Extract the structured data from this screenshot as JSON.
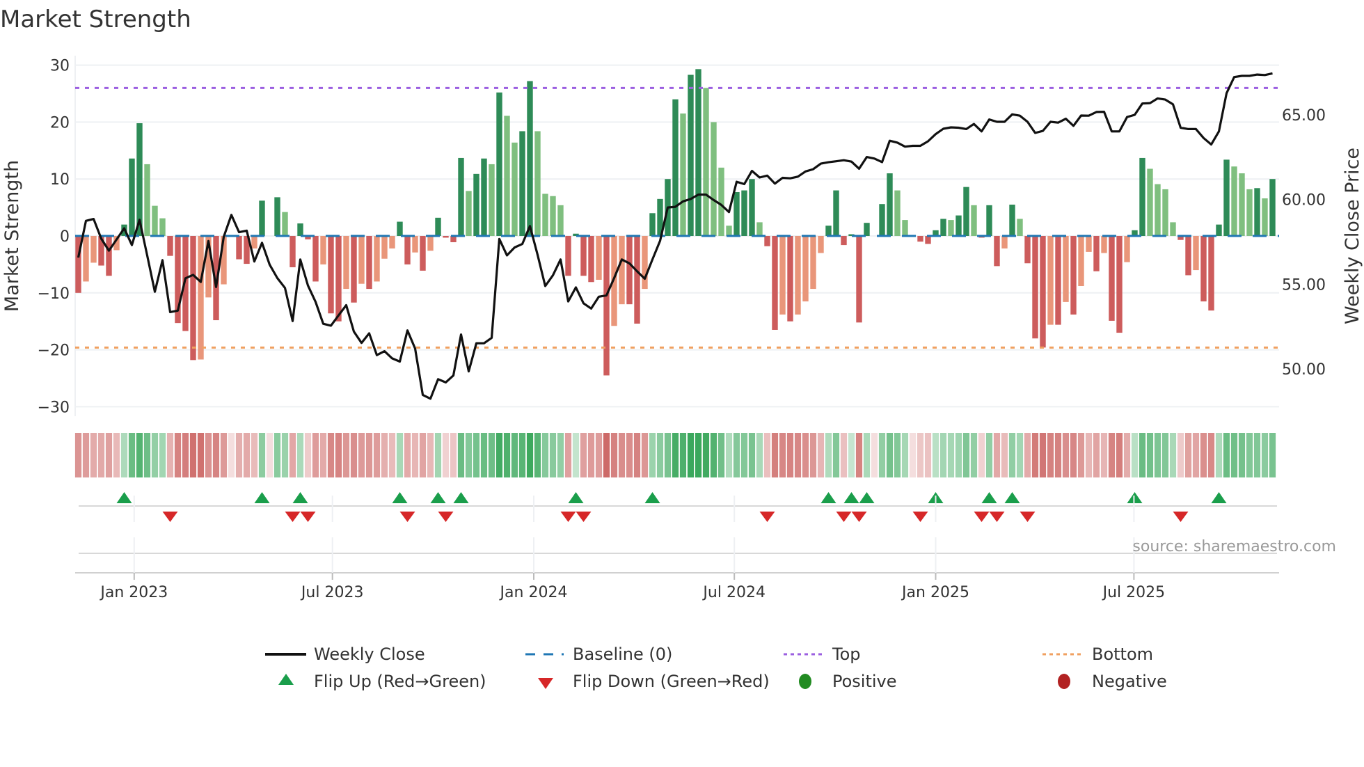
{
  "chart_data": {
    "type": "bar",
    "title": "Market Strength",
    "ylabel": "Market Strength",
    "y2label": "Weekly Close Price",
    "ylim": [
      -31.5,
      33
    ],
    "y2lim": [
      47.7,
      67.9
    ],
    "yticks": [
      "30",
      "20",
      "10",
      "0",
      "−10",
      "−20",
      "−30"
    ],
    "ytick_values": [
      30,
      20,
      10,
      0,
      -10,
      -20,
      -30
    ],
    "y2ticks": [
      "65.00",
      "60.00",
      "55.00",
      "50.00"
    ],
    "y2tick_values": [
      65,
      60,
      55,
      50
    ],
    "xticks": [
      "Jan 2023",
      "Jul 2023",
      "Jan 2024",
      "Jul 2024",
      "Jan 2025",
      "Jul 2025"
    ],
    "xtick_week_index": [
      7.3,
      33.2,
      59.5,
      85.7,
      112,
      137.9
    ],
    "top_level": 26,
    "bottom_level": -19.6,
    "baseline": 0,
    "colors": {
      "positive_strong": "#2e8b57",
      "positive_weak": "#7fbf7f",
      "negative_strong": "#cd5c5c",
      "negative_weak": "#e9967a",
      "baseline": "#1f77b4",
      "top": "#9b5fe0",
      "bottom": "#f0a060",
      "close": "#111111",
      "flip_up": "#1a9e4b",
      "flip_down": "#d62728",
      "positive_dot": "#228b22",
      "negative_dot": "#b22222"
    },
    "strength": [
      -10,
      -8,
      -4.7,
      -5.2,
      -7,
      -2.5,
      2,
      13.6,
      19.8,
      12.6,
      5.3,
      3.1,
      -3.5,
      -15.3,
      -16.7,
      -21.8,
      -21.7,
      -10.8,
      -14.8,
      -8.5,
      0,
      -4.1,
      -4.9,
      -2.2,
      6.2,
      0,
      6.8,
      4.2,
      -5.5,
      2.2,
      -0.6,
      -8,
      -5,
      -13.6,
      -15,
      -9.3,
      -11.7,
      -8.4,
      -9.3,
      -8,
      -4,
      -2.2,
      2.5,
      -5,
      -2.9,
      -6.1,
      -2.6,
      3.2,
      -0.3,
      -1.1,
      13.7,
      7.9,
      10.9,
      13.6,
      12.6,
      25.2,
      21.1,
      16.4,
      18.4,
      27.2,
      18.4,
      7.4,
      7,
      5.4,
      -7,
      0.4,
      -7,
      -8.1,
      -7.7,
      -24.5,
      -15.8,
      -12,
      -12,
      -15.4,
      -9.3,
      4,
      6.5,
      10,
      24,
      21.5,
      28.3,
      29.3,
      26,
      20,
      12,
      1.8,
      7.7,
      8,
      10,
      2.4,
      -1.8,
      -16.5,
      -13.8,
      -15,
      -13.8,
      -11.5,
      -9.3,
      -3,
      1.8,
      8,
      -1.6,
      0.3,
      -15.2,
      2.3,
      0,
      5.6,
      11,
      8,
      2.8,
      0,
      -1,
      -1.4,
      1,
      3,
      2.8,
      3.6,
      8.6,
      5.4,
      -0.3,
      5.4,
      -5.3,
      -2.2,
      5.5,
      3,
      -4.8,
      -18,
      -19.6,
      -15.6,
      -15.6,
      -11.6,
      -13.8,
      -8.8,
      -2.8,
      -6.2,
      -3,
      -14.9,
      -17,
      -4.6,
      1,
      13.7,
      11.8,
      9.1,
      8.2,
      2.4,
      -0.7,
      -6.9,
      -6,
      -11.5,
      -13.1,
      2,
      13.4,
      12.2,
      11,
      8.2,
      8.4,
      6.6,
      10
    ],
    "weekly_close": [
      56.57,
      58.74,
      58.85,
      57.69,
      56.98,
      57.64,
      58.3,
      57.31,
      58.8,
      56.7,
      54.55,
      56.42,
      53.35,
      53.44,
      55.35,
      55.55,
      55.13,
      57.55,
      54.83,
      57.8,
      59.09,
      58.07,
      58.16,
      56.34,
      57.44,
      56.15,
      55.36,
      54.78,
      52.82,
      56.46,
      54.92,
      53.95,
      52.66,
      52.55,
      53.16,
      53.76,
      52.2,
      51.53,
      52.1,
      50.81,
      51.04,
      50.62,
      50.43,
      52.27,
      51.2,
      48.46,
      48.24,
      49.39,
      49.2,
      49.61,
      52.03,
      49.85,
      51.51,
      51.51,
      51.83,
      57.67,
      56.7,
      57.17,
      57.37,
      58.43,
      56.73,
      54.89,
      55.52,
      56.46,
      53.98,
      54.81,
      53.87,
      53.56,
      54.26,
      54.34,
      55.36,
      56.46,
      56.23,
      55.76,
      55.32,
      56.46,
      57.56,
      59.53,
      59.57,
      59.89,
      60.03,
      60.29,
      60.29,
      59.97,
      59.68,
      59.26,
      61.05,
      60.91,
      61.69,
      61.3,
      61.41,
      60.94,
      61.28,
      61.25,
      61.35,
      61.66,
      61.79,
      62.12,
      62.2,
      62.26,
      62.32,
      62.24,
      61.82,
      62.51,
      62.42,
      62.21,
      63.47,
      63.36,
      63.12,
      63.17,
      63.17,
      63.44,
      63.86,
      64.18,
      64.26,
      64.24,
      64.16,
      64.46,
      64.02,
      64.73,
      64.59,
      64.59,
      65.03,
      64.95,
      64.59,
      63.93,
      64.05,
      64.59,
      64.54,
      64.77,
      64.35,
      64.96,
      64.95,
      65.17,
      65.18,
      64.02,
      64.02,
      64.87,
      65.0,
      65.67,
      65.69,
      65.97,
      65.9,
      65.62,
      64.24,
      64.16,
      64.16,
      63.63,
      63.25,
      64.02,
      66.28,
      67.23,
      67.3,
      67.3,
      67.38,
      67.35,
      67.45
    ],
    "flip_up_weeks": [
      6,
      24,
      29,
      42,
      47,
      50,
      65,
      75,
      98,
      101,
      103,
      112,
      119,
      122,
      138,
      149
    ],
    "flip_down_weeks": [
      12,
      28,
      30,
      43,
      48,
      64,
      66,
      90,
      100,
      102,
      110,
      118,
      120,
      124,
      144
    ],
    "legend": {
      "weekly_close": "Weekly Close",
      "baseline": "Baseline (0)",
      "top": "Top",
      "bottom": "Bottom",
      "flip_up": "Flip Up (Red→Green)",
      "flip_down": "Flip Down (Green→Red)",
      "positive": "Positive",
      "negative": "Negative"
    },
    "legend_position": "bottom",
    "grid": true,
    "source": "source: sharemaestro.com"
  }
}
